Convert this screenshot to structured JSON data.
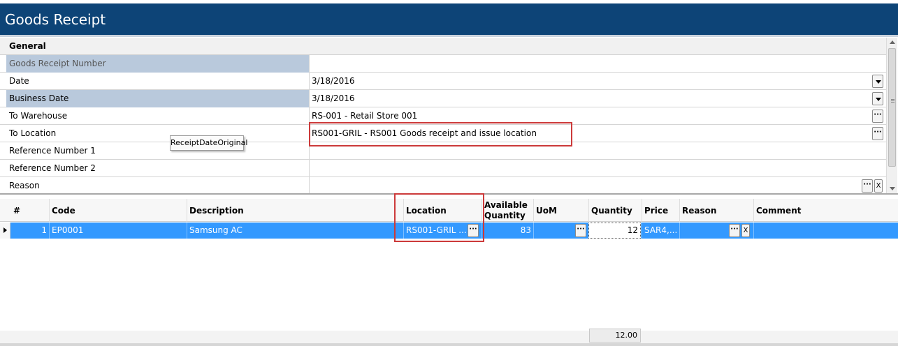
{
  "window": {
    "title": "Goods Receipt"
  },
  "properties": {
    "section": "General",
    "rows": [
      {
        "label": "Goods Receipt Number",
        "value": ""
      },
      {
        "label": "Date",
        "value": "3/18/2016"
      },
      {
        "label": "Business Date",
        "value": "3/18/2016"
      },
      {
        "label": "To Warehouse",
        "value": "RS-001 - Retail Store 001"
      },
      {
        "label": "To Location",
        "value": "RS001-GRIL - RS001 Goods receipt and issue location"
      },
      {
        "label": "Reference Number 1",
        "value": ""
      },
      {
        "label": "Reference Number 2",
        "value": ""
      },
      {
        "label": "Reason",
        "value": ""
      }
    ]
  },
  "tooltip": "ReceiptDateOriginal",
  "buttons": {
    "ellipsis": "···",
    "clear": "X"
  },
  "grid": {
    "columns": {
      "num": "#",
      "code": "Code",
      "description": "Description",
      "location": "Location",
      "available_1": "Available",
      "available_2": "Quantity",
      "uom": "UoM",
      "quantity": "Quantity",
      "price": "Price",
      "reason": "Reason",
      "comment": "Comment"
    },
    "rows": [
      {
        "num": "1",
        "code": "EP0001",
        "description": "Samsung AC",
        "location": "RS001-GRIL ...",
        "available": "83",
        "uom": "",
        "quantity": "12",
        "price": "SAR4,...",
        "reason": "",
        "comment": ""
      }
    ],
    "footer": {
      "quantity_total": "12.00"
    }
  },
  "colors": {
    "title_bar": "#0d4477",
    "selection": "#3399ff",
    "highlight_box": "#cc3a3a"
  }
}
